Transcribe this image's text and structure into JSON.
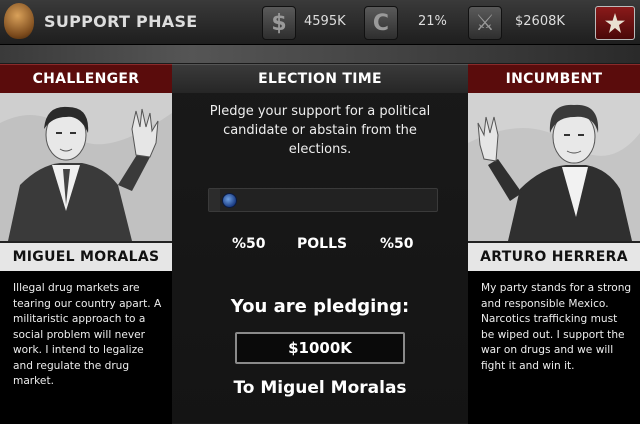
{
  "header": {
    "phase_title": "SUPPORT PHASE",
    "stats": [
      {
        "icon": "money-icon",
        "glyph": "$",
        "value": "4595K"
      },
      {
        "icon": "support-icon",
        "glyph": "C",
        "value": "21%"
      },
      {
        "icon": "weapon-icon",
        "glyph": "⚔",
        "value": "$2608K"
      }
    ]
  },
  "challenger": {
    "role": "CHALLENGER",
    "name": "MIGUEL MORALAS",
    "bio": "Illegal drug markets are tearing our country apart. A militaristic approach to a social problem will never work. I intend to legalize and regulate the drug market."
  },
  "incumbent": {
    "role": "INCUMBENT",
    "name": "ARTURO HERRERA",
    "bio": "My party stands for a strong and responsible Mexico. Narcotics trafficking must be wiped out. I support the war on drugs and we will fight it and win it."
  },
  "election": {
    "title": "ELECTION TIME",
    "instruction": "Pledge your support for a political candidate or abstain from the elections.",
    "poll_position": 0.05,
    "poll_left": "%50",
    "poll_label": "POLLS",
    "poll_right": "%50",
    "pledge_label": "You are pledging:",
    "pledge_amount": "$1000K",
    "pledge_target": "To Miguel Moralas"
  },
  "colors": {
    "panel_red": "#5a0c0c",
    "knob_blue": "#2c5bb0"
  }
}
